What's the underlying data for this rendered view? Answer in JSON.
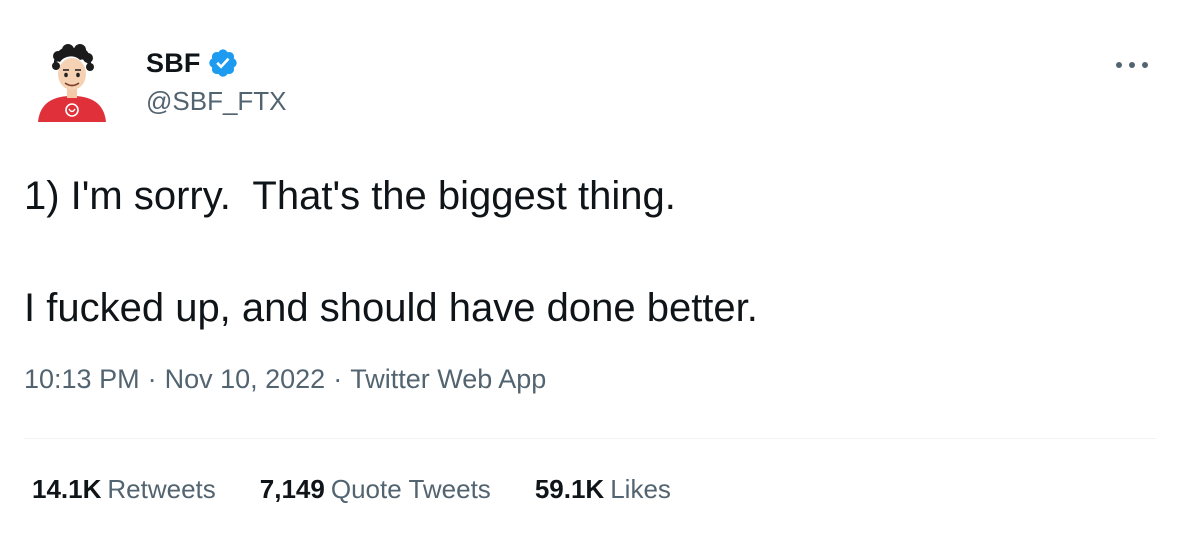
{
  "author": {
    "name": "SBF",
    "handle": "@SBF_FTX",
    "verified": true,
    "avatar_icon": "profile-avatar-cartoon-red-shirt"
  },
  "tweet": {
    "text": "1) I'm sorry.  That's the biggest thing.\n\nI fucked up, and should have done better."
  },
  "meta": {
    "time": "10:13 PM",
    "separator": "·",
    "date": "Nov 10, 2022",
    "source": "Twitter Web App"
  },
  "stats": {
    "retweets_count": "14.1K",
    "retweets_label": "Retweets",
    "quotes_count": "7,149",
    "quotes_label": "Quote Tweets",
    "likes_count": "59.1K",
    "likes_label": "Likes"
  },
  "icons": {
    "verified_badge": "verified-badge-icon",
    "more": "more-options-icon"
  },
  "colors": {
    "text": "#0f1419",
    "secondary": "#536471",
    "verified": "#1d9bf0",
    "divider": "#eff3f4",
    "avatar_shirt": "#e0303a"
  }
}
